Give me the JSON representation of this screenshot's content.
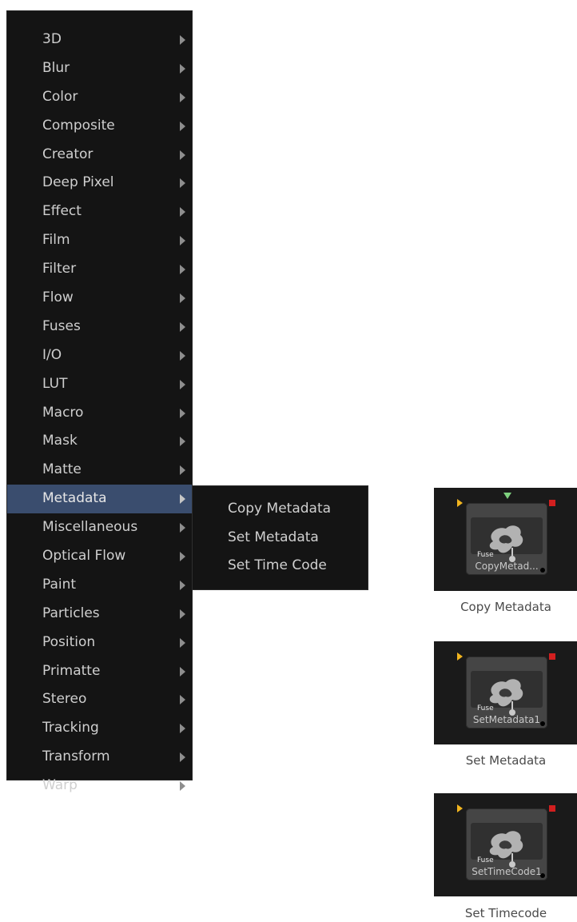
{
  "menu": {
    "items": [
      {
        "label": "3D"
      },
      {
        "label": "Blur"
      },
      {
        "label": "Color"
      },
      {
        "label": "Composite"
      },
      {
        "label": "Creator"
      },
      {
        "label": "Deep Pixel"
      },
      {
        "label": "Effect"
      },
      {
        "label": "Film"
      },
      {
        "label": "Filter"
      },
      {
        "label": "Flow"
      },
      {
        "label": "Fuses"
      },
      {
        "label": "I/O"
      },
      {
        "label": "LUT"
      },
      {
        "label": "Macro"
      },
      {
        "label": "Mask"
      },
      {
        "label": "Matte"
      },
      {
        "label": "Metadata"
      },
      {
        "label": "Miscellaneous"
      },
      {
        "label": "Optical Flow"
      },
      {
        "label": "Paint"
      },
      {
        "label": "Particles"
      },
      {
        "label": "Position"
      },
      {
        "label": "Primatte"
      },
      {
        "label": "Stereo"
      },
      {
        "label": "Tracking"
      },
      {
        "label": "Transform"
      },
      {
        "label": "Warp"
      }
    ],
    "active_item": "Metadata"
  },
  "submenu": {
    "items": [
      {
        "label": "Copy Metadata"
      },
      {
        "label": "Set Metadata"
      },
      {
        "label": "Set Time Code"
      }
    ]
  },
  "nodes": [
    {
      "name": "CopyMetad...",
      "badge": "Fuse",
      "caption": "Copy Metadata"
    },
    {
      "name": "SetMetadata1",
      "badge": "Fuse",
      "caption": "Set Metadata"
    },
    {
      "name": "SetTimeCode1",
      "badge": "Fuse",
      "caption": "Set Timecode"
    }
  ],
  "colors": {
    "menu_bg": "#141414",
    "highlight": "#3a4d6e",
    "input_arrow": "#f2b51f",
    "output_square": "#d21f1f",
    "mask_input": "#7fd17f"
  }
}
